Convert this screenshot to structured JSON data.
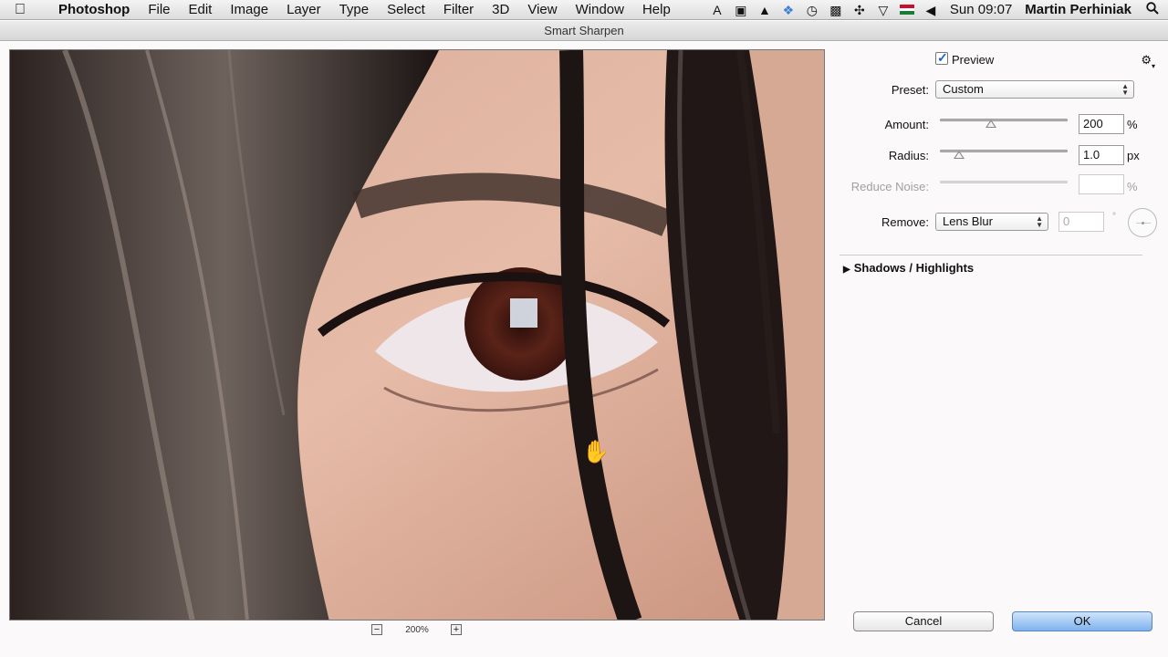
{
  "menubar": {
    "apple_icon": "apple-icon",
    "app_name": "Photoshop",
    "items": [
      "File",
      "Edit",
      "Image",
      "Layer",
      "Type",
      "Select",
      "Filter",
      "3D",
      "View",
      "Window",
      "Help"
    ],
    "status_icons": [
      "adobe-icon",
      "camera-icon",
      "drive-icon",
      "dropbox-icon",
      "timemachine-icon",
      "display-icon",
      "move-icon",
      "wifi-icon",
      "flag-icon",
      "volume-icon"
    ],
    "clock": "Sun 09:07",
    "user": "Martin Perhiniak",
    "spotlight_icon": "search-icon"
  },
  "window": {
    "title": "Smart Sharpen"
  },
  "preview": {
    "zoom_out_label": "−",
    "zoom_in_label": "+",
    "zoom_level": "200%"
  },
  "panel": {
    "preview_label": "Preview",
    "preview_checked": true,
    "gear_icon": "gear-icon",
    "preset": {
      "label": "Preset:",
      "value": "Custom"
    },
    "amount": {
      "label": "Amount:",
      "value": "200",
      "unit": "%",
      "level": 0.4
    },
    "radius": {
      "label": "Radius:",
      "value": "1.0",
      "unit": "px",
      "level": 0.15
    },
    "reduce_noise": {
      "label": "Reduce Noise:",
      "value": "",
      "unit": "%"
    },
    "remove": {
      "label": "Remove:",
      "value": "Lens Blur",
      "angle": "0",
      "angle_unit": "°"
    },
    "shadows_highlights": "Shadows / Highlights"
  },
  "buttons": {
    "cancel": "Cancel",
    "ok": "OK"
  },
  "colors": {
    "ok_button": "#7fb2ee",
    "accent": "#1e5fc8"
  }
}
